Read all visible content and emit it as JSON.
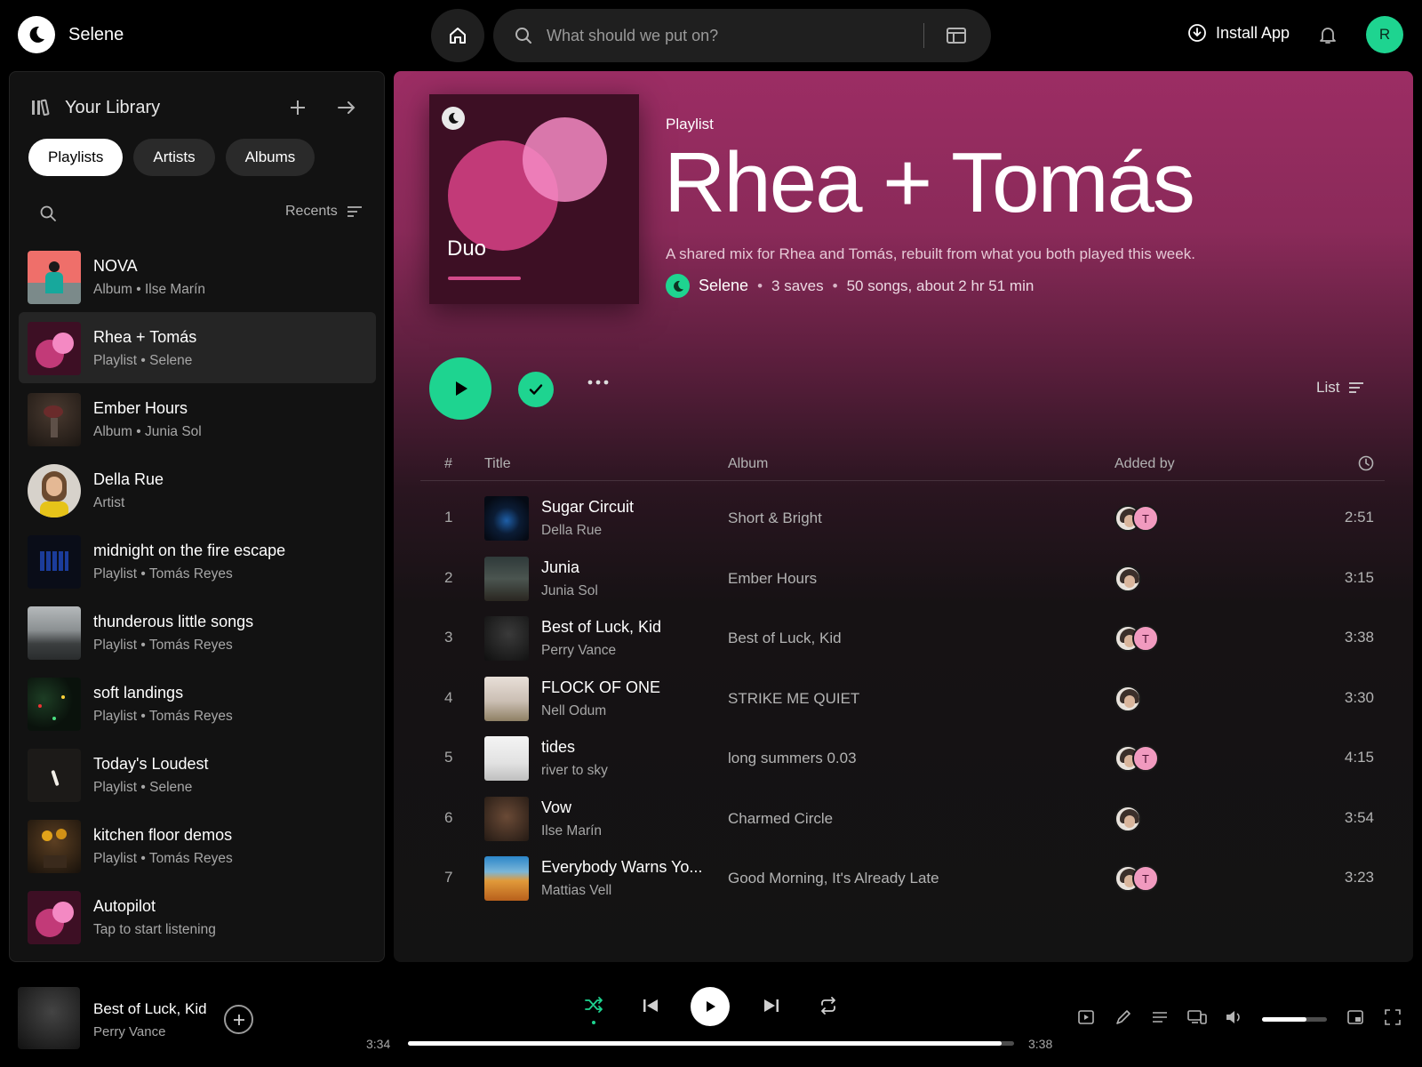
{
  "app": {
    "brand": "Selene"
  },
  "topbar": {
    "search_placeholder": "What should we put on?",
    "install_label": "Install App",
    "avatar_initial": "R"
  },
  "library": {
    "title": "Your Library",
    "chips": [
      "Playlists",
      "Artists",
      "Albums"
    ],
    "active_chip": "Playlists",
    "sort_label": "Recents",
    "items": [
      {
        "name": "NOVA",
        "sub": "Album • Ilse Marín"
      },
      {
        "name": "Rhea + Tomás",
        "sub": "Playlist • Selene",
        "selected": true
      },
      {
        "name": "Ember Hours",
        "sub": "Album • Junia Sol"
      },
      {
        "name": "Della Rue",
        "sub": "Artist"
      },
      {
        "name": "midnight on the fire escape",
        "sub": "Playlist • Tomás Reyes"
      },
      {
        "name": "thunderous little songs",
        "sub": "Playlist • Tomás Reyes"
      },
      {
        "name": "soft landings",
        "sub": "Playlist • Tomás Reyes"
      },
      {
        "name": "Today's Loudest",
        "sub": "Playlist • Selene"
      },
      {
        "name": "kitchen floor demos",
        "sub": "Playlist • Tomás Reyes"
      },
      {
        "name": "Autopilot",
        "sub": "Tap to start listening"
      }
    ]
  },
  "playlist": {
    "cover_label": "Duo",
    "type": "Playlist",
    "title": "Rhea + Tomás",
    "description": "A shared mix for Rhea and Tomás, rebuilt from what you both played this week.",
    "owner": "Selene",
    "saves": "3 saves",
    "summary": "50 songs, about 2 hr 51 min",
    "view_mode": "List",
    "columns": {
      "num": "#",
      "title": "Title",
      "album": "Album",
      "added_by": "Added by"
    },
    "tracks": [
      {
        "num": "1",
        "title": "Sugar Circuit",
        "artist": "Della Rue",
        "album": "Short & Bright",
        "added": [
          "R",
          "T"
        ],
        "duration": "2:51"
      },
      {
        "num": "2",
        "title": "Junia",
        "artist": "Junia Sol",
        "album": "Ember Hours",
        "added": [
          "R"
        ],
        "duration": "3:15"
      },
      {
        "num": "3",
        "title": "Best of Luck, Kid",
        "artist": "Perry Vance",
        "album": "Best of Luck, Kid",
        "added": [
          "R",
          "T"
        ],
        "duration": "3:38"
      },
      {
        "num": "4",
        "title": "FLOCK OF ONE",
        "artist": "Nell Odum",
        "album": "STRIKE ME QUIET",
        "added": [
          "R"
        ],
        "duration": "3:30"
      },
      {
        "num": "5",
        "title": "tides",
        "artist": "river to sky",
        "album": "long summers 0.03",
        "added": [
          "R",
          "T"
        ],
        "duration": "4:15"
      },
      {
        "num": "6",
        "title": "Vow",
        "artist": "Ilse Marín",
        "album": "Charmed Circle",
        "added": [
          "R"
        ],
        "duration": "3:54"
      },
      {
        "num": "7",
        "title": "Everybody Warns Yo...",
        "artist": "Mattias Vell",
        "album": "Good Morning, It's Already Late",
        "added": [
          "R",
          "T"
        ],
        "duration": "3:23"
      }
    ]
  },
  "now_playing": {
    "title": "Best of Luck, Kid",
    "artist": "Perry Vance",
    "elapsed": "3:34",
    "total": "3:38",
    "progress_fraction": 0.98,
    "volume_fraction": 0.68,
    "shuffle_on": true
  },
  "colors": {
    "accent": "#1ed490",
    "header_gradient_top": "#9c2d64",
    "pink_badge": "#f19abf"
  }
}
